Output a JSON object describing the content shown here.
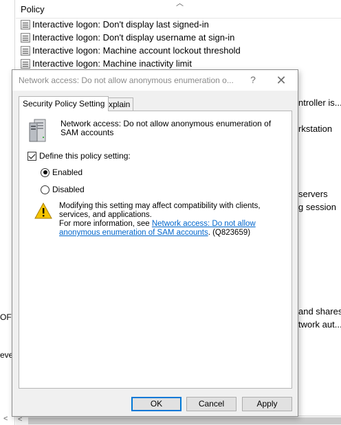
{
  "background": {
    "header": "Policy",
    "policies": [
      "Interactive logon: Don't display last signed-in",
      "Interactive logon: Don't display username at sign-in",
      "Interactive logon: Machine account lockout threshold",
      "Interactive logon: Machine inactivity limit"
    ],
    "right_fragments": [
      "ntroller is...",
      "rkstation",
      "servers",
      "g session",
      "and shares",
      "twork aut..."
    ],
    "left_fragments": [
      "OFT",
      "eve"
    ]
  },
  "dialog": {
    "title": "Network access: Do not allow anonymous enumeration o...",
    "help_glyph": "?",
    "close_glyph": "✕",
    "tabs": [
      "Security Policy Setting",
      "Explain"
    ],
    "policy_name": "Network access: Do not allow anonymous enumeration of SAM accounts",
    "define_label": "Define this policy setting:",
    "define_checked": true,
    "radio_enabled": "Enabled",
    "radio_disabled": "Disabled",
    "selected_option": "Enabled",
    "warning": {
      "line1": "Modifying this setting may affect compatibility with clients, services, and applications.",
      "prefix": "For more information, see ",
      "link": "Network access: Do not allow anonymous enumeration of SAM accounts",
      "suffix": ". (Q823659)"
    },
    "buttons": {
      "ok": "OK",
      "cancel": "Cancel",
      "apply": "Apply"
    }
  },
  "colors": {
    "link": "#0066cc",
    "dialog_bg": "#f0f0f0",
    "focus": "#0078d7",
    "warning": "#f5c400"
  },
  "icons": [
    "policy-icon",
    "server-icon",
    "warning-icon",
    "help-icon",
    "close-icon",
    "chevron-up-icon",
    "chevron-left-icon"
  ]
}
